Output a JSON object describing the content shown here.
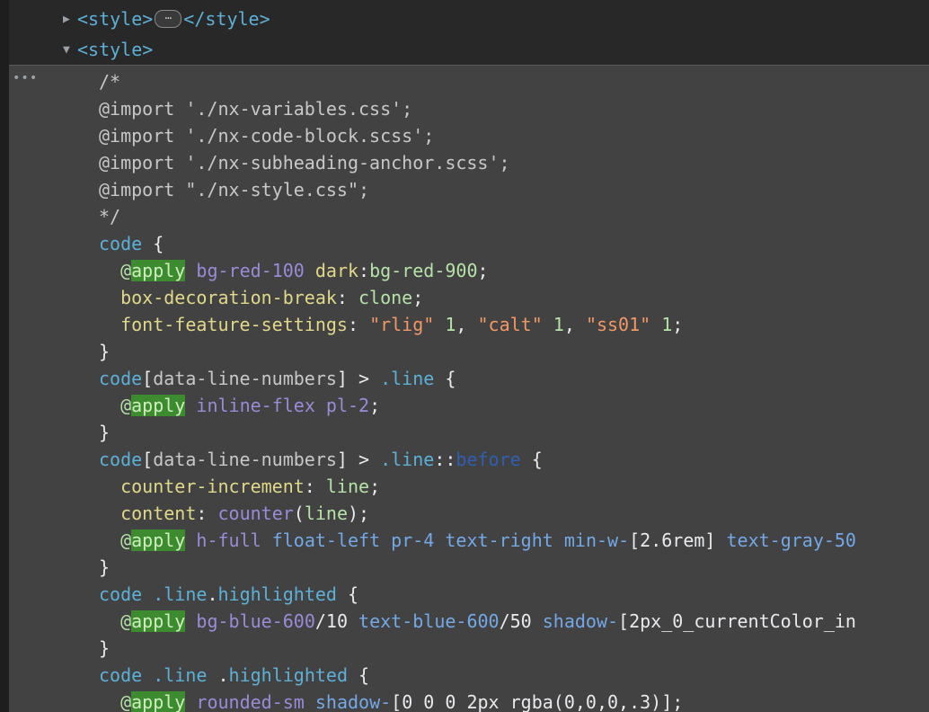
{
  "elements": {
    "collapsed": {
      "open": "<style>",
      "ellipsis": "⋯",
      "close": "</style>"
    },
    "expanded": {
      "open": "<style>"
    }
  },
  "code": {
    "comment_open": "/*",
    "imports": [
      "@import './nx-variables.css';",
      "@import './nx-code-block.scss';",
      "@import './nx-subheading-anchor.scss';",
      "@import \"./nx-style.css\";"
    ],
    "comment_close": "*/",
    "rules": {
      "code_selector": "code",
      "apply": "apply",
      "at": "@",
      "bg_red_100": "bg-red-100",
      "dark_bg": "dark",
      "bg_red_900": "bg-red-900",
      "box_decoration_break": "box-decoration-break",
      "clone": "clone",
      "font_feature_settings": "font-feature-settings",
      "rlig": "\"rlig\"",
      "calt": "\"calt\"",
      "ss01": "\"ss01\"",
      "one": "1",
      "data_line_numbers": "data-line-numbers",
      "line_class": ".line",
      "inline_flex": "inline-flex",
      "pl_2": "pl-2",
      "before": "before",
      "counter_increment": "counter-increment",
      "line_val": "line",
      "content": "content",
      "counter": "counter",
      "h_full": "h-full",
      "float_left": "float-left",
      "pr_4": "pr-4",
      "text_right": "text-right",
      "min_w": "min-w-",
      "min_w_val": "[2.6rem]",
      "text_gray": "text-gray-50",
      "highlighted": "highlighted",
      "bg_blue_600": "bg-blue-600",
      "ten": "/10",
      "text_blue_600": "text-blue-600",
      "fifty": "/50",
      "shadow": "shadow-",
      "shadow_val_1": "[2px_0_currentColor_in",
      "rounded_sm": "rounded-sm",
      "shadow_val_2": "[0_0_0_2px_rgba(0,0,0,.3)];"
    }
  }
}
